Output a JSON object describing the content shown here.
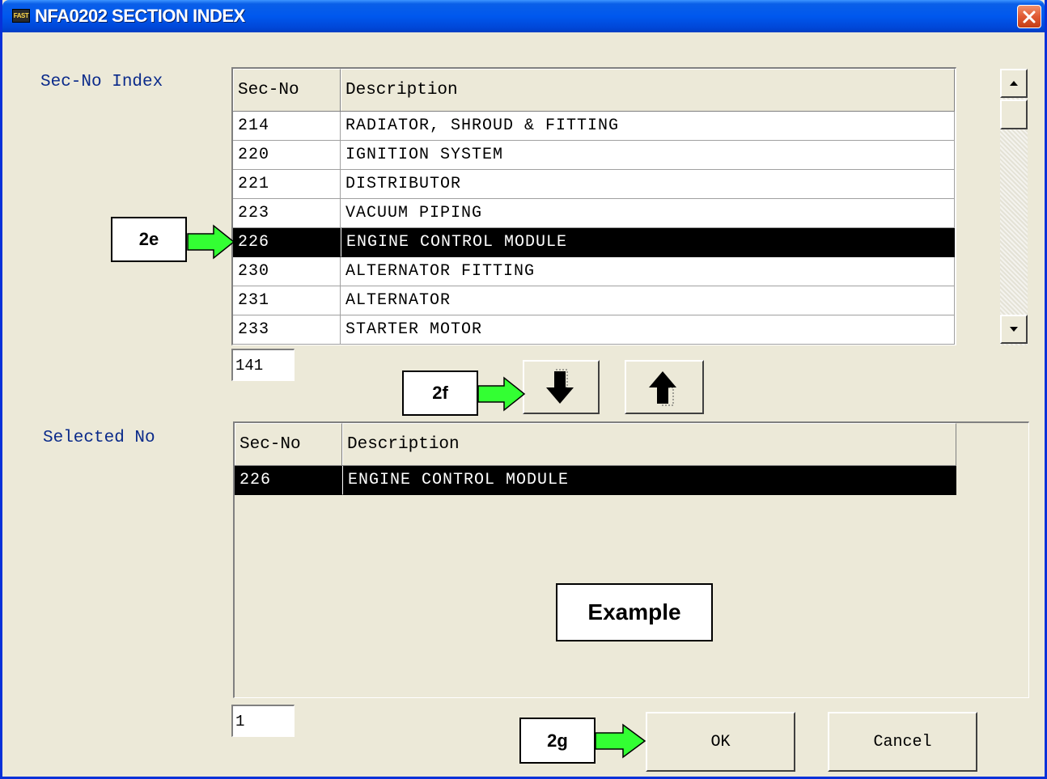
{
  "window": {
    "title": "NFA0202 SECTION INDEX",
    "app_icon_text": "FAST",
    "close_label": "×"
  },
  "index_section": {
    "label": "Sec-No Index",
    "columns": [
      "Sec-No",
      "Description"
    ],
    "rows": [
      {
        "sec": "214",
        "desc": "RADIATOR, SHROUD & FITTING"
      },
      {
        "sec": "220",
        "desc": "IGNITION SYSTEM"
      },
      {
        "sec": "221",
        "desc": "DISTRIBUTOR"
      },
      {
        "sec": "223",
        "desc": "VACUUM PIPING"
      },
      {
        "sec": "226",
        "desc": "ENGINE CONTROL MODULE"
      },
      {
        "sec": "230",
        "desc": "ALTERNATOR FITTING"
      },
      {
        "sec": "231",
        "desc": "ALTERNATOR"
      },
      {
        "sec": "233",
        "desc": "STARTER MOTOR"
      }
    ],
    "selected_row": 4,
    "count": "141"
  },
  "selected_section": {
    "label": "Selected No",
    "columns": [
      "Sec-No",
      "Description"
    ],
    "rows": [
      {
        "sec": "226",
        "desc": "ENGINE CONTROL MODULE"
      }
    ],
    "count": "1"
  },
  "buttons": {
    "add_icon": "arrow-down-icon",
    "remove_icon": "arrow-up-icon",
    "ok": "OK",
    "cancel": "Cancel"
  },
  "callouts": {
    "step_2e": "2e",
    "step_2f": "2f",
    "step_2g": "2g",
    "example": "Example"
  },
  "colors": {
    "title_bar": "#0058ee",
    "window_bg": "#ece9d8",
    "selected_row": "#000000",
    "label_text": "#0a2a8a",
    "callout_arrow": "#33ff33"
  }
}
